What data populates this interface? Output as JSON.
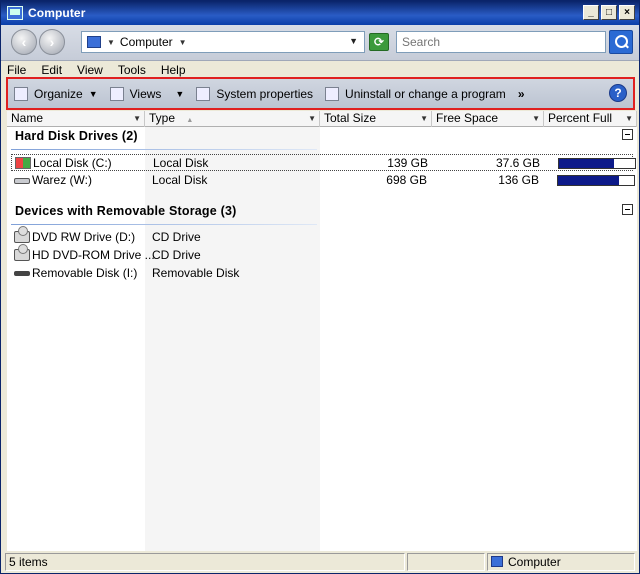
{
  "window": {
    "title": "Computer"
  },
  "title_buttons": {
    "minimize": "_",
    "maximize": "□",
    "close": "×"
  },
  "address": {
    "crumb": "Computer"
  },
  "search": {
    "placeholder": "Search"
  },
  "menu": [
    "File",
    "Edit",
    "View",
    "Tools",
    "Help"
  ],
  "toolbar": {
    "organize": "Organize",
    "views": "Views",
    "system_properties": "System properties",
    "uninstall": "Uninstall or change a program",
    "more": "»",
    "help": "?"
  },
  "columns": {
    "name": "Name",
    "type": "Type",
    "total_size": "Total Size",
    "free_space": "Free Space",
    "percent_full": "Percent Full"
  },
  "groups": [
    {
      "title": "Hard Disk Drives (2)",
      "items": [
        {
          "name": "Local Disk (C:)",
          "type": "Local Disk",
          "total": "139 GB",
          "free": "37.6 GB",
          "percent_full": 73,
          "icon": "windows-drive-icon"
        },
        {
          "name": "Warez (W:)",
          "type": "Local Disk",
          "total": "698 GB",
          "free": "136 GB",
          "percent_full": 80,
          "icon": "hard-drive-icon"
        }
      ]
    },
    {
      "title": "Devices with Removable Storage (3)",
      "items": [
        {
          "name": "DVD RW Drive (D:)",
          "type": "CD Drive",
          "icon": "dvd-drive-icon"
        },
        {
          "name": "HD DVD-ROM Drive ...",
          "type": "CD Drive",
          "icon": "dvd-drive-icon"
        },
        {
          "name": "Removable Disk (I:)",
          "type": "Removable Disk",
          "icon": "removable-disk-icon"
        }
      ]
    }
  ],
  "status": {
    "items": "5 items",
    "location": "Computer"
  },
  "colors": {
    "toolbar_highlight": "#e02020",
    "bar_fill": "#0d1a8a",
    "title_bar": "#0a246a"
  }
}
